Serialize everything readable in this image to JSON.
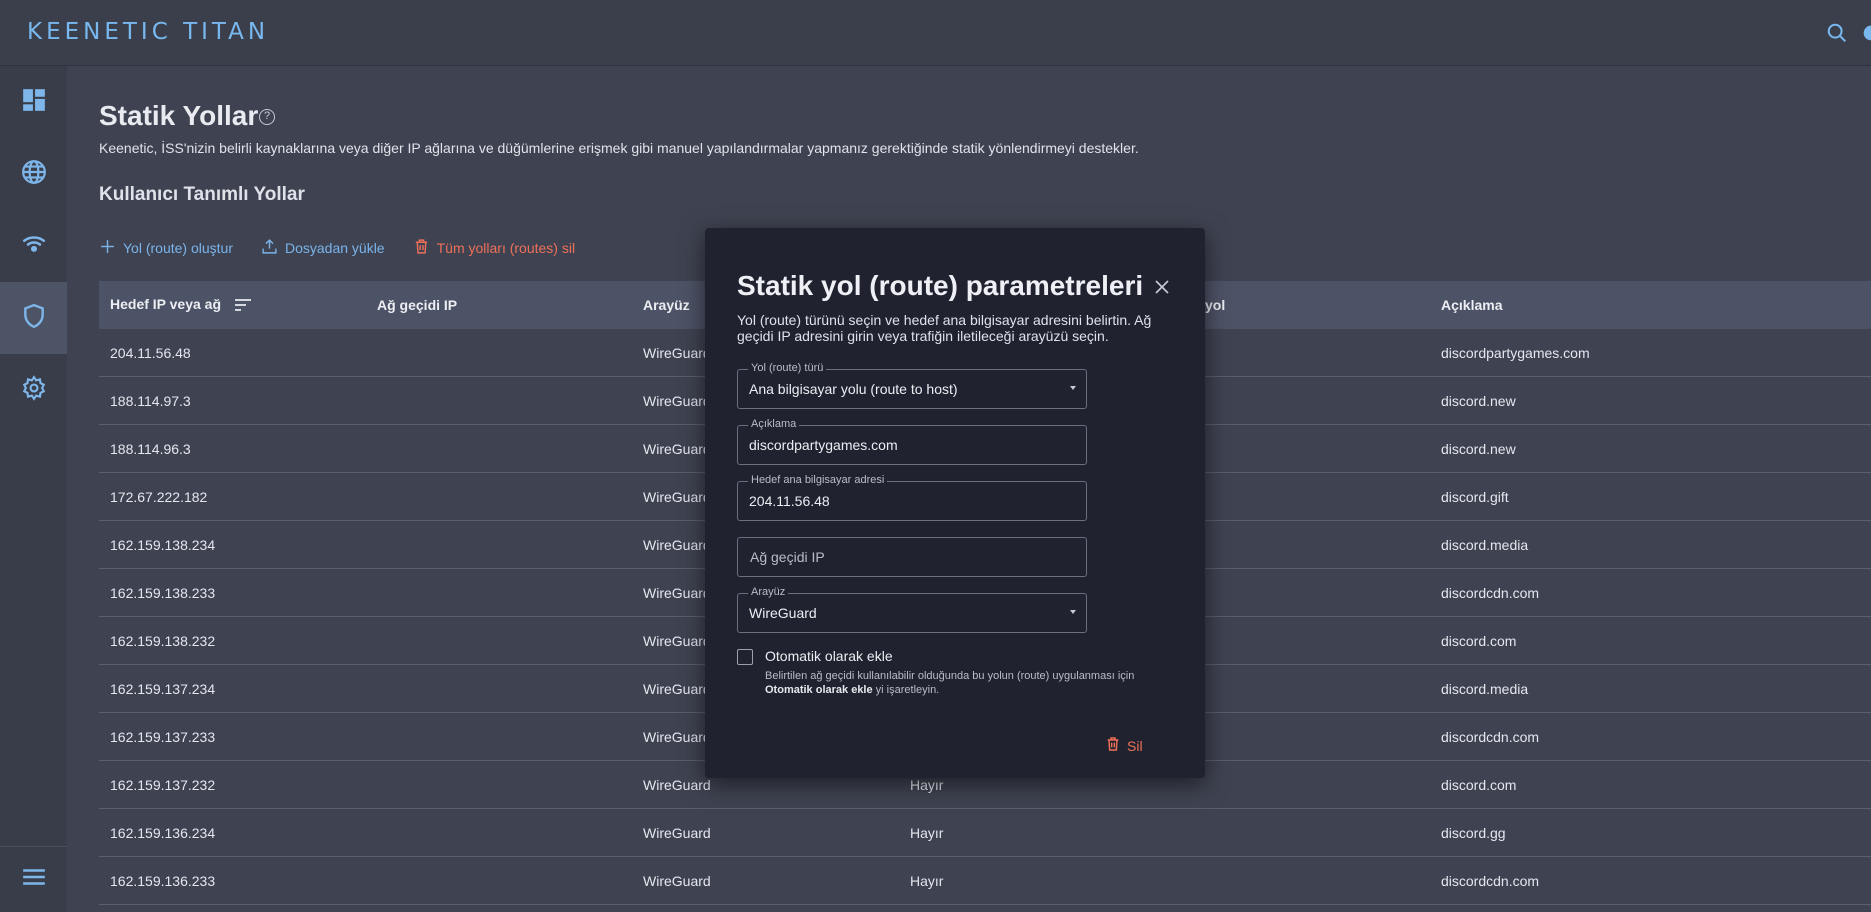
{
  "app": {
    "logo": "KEENETIC TITAN"
  },
  "topbar": {
    "search_icon": "search-icon",
    "settings_icon": "gear-icon"
  },
  "sidebar": {
    "items": [
      {
        "name": "dashboard",
        "icon": "dashboard-icon",
        "active": false
      },
      {
        "name": "internet",
        "icon": "globe-icon",
        "active": false
      },
      {
        "name": "wifi",
        "icon": "wifi-icon",
        "active": false
      },
      {
        "name": "security",
        "icon": "shield-icon",
        "active": true
      },
      {
        "name": "management",
        "icon": "gear-icon",
        "active": false
      }
    ],
    "menu_icon": "menu-icon"
  },
  "page": {
    "title": "Statik Yollar",
    "description": "Keenetic, İSS'nizin belirli kaynaklarına veya diğer IP ağlarına ve düğümlerine erişmek gibi manuel yapılandırmalar yapmanız gerektiğinde statik yönlendirmeyi destekler.",
    "section_title": "Kullanıcı Tanımlı Yollar"
  },
  "actions": {
    "create": "Yol (route) oluştur",
    "upload": "Dosyadan yükle",
    "delete_all": "Tüm yolları (routes) sil"
  },
  "table": {
    "headers": [
      "Hedef IP veya ağ",
      "Ağ geçidi IP",
      "Arayüz",
      "",
      "yol",
      "Açıklama"
    ],
    "rows": [
      {
        "dest": "204.11.56.48",
        "gateway": "",
        "iface": "WireGuard",
        "auto": "",
        "desc": "discordpartygames.com"
      },
      {
        "dest": "188.114.97.3",
        "gateway": "",
        "iface": "WireGuard",
        "auto": "",
        "desc": "discord.new"
      },
      {
        "dest": "188.114.96.3",
        "gateway": "",
        "iface": "WireGuard",
        "auto": "",
        "desc": "discord.new"
      },
      {
        "dest": "172.67.222.182",
        "gateway": "",
        "iface": "WireGuard",
        "auto": "",
        "desc": "discord.gift"
      },
      {
        "dest": "162.159.138.234",
        "gateway": "",
        "iface": "WireGuard",
        "auto": "",
        "desc": "discord.media"
      },
      {
        "dest": "162.159.138.233",
        "gateway": "",
        "iface": "WireGuard",
        "auto": "",
        "desc": "discordcdn.com"
      },
      {
        "dest": "162.159.138.232",
        "gateway": "",
        "iface": "WireGuard",
        "auto": "",
        "desc": "discord.com"
      },
      {
        "dest": "162.159.137.234",
        "gateway": "",
        "iface": "WireGuard",
        "auto": "",
        "desc": "discord.media"
      },
      {
        "dest": "162.159.137.233",
        "gateway": "",
        "iface": "WireGuard",
        "auto": "",
        "desc": "discordcdn.com"
      },
      {
        "dest": "162.159.137.232",
        "gateway": "",
        "iface": "WireGuard",
        "auto": "Hayır",
        "desc": "discord.com"
      },
      {
        "dest": "162.159.136.234",
        "gateway": "",
        "iface": "WireGuard",
        "auto": "Hayır",
        "desc": "discord.gg"
      },
      {
        "dest": "162.159.136.233",
        "gateway": "",
        "iface": "WireGuard",
        "auto": "Hayır",
        "desc": "discordcdn.com"
      }
    ]
  },
  "dialog": {
    "title": "Statik yol (route) parametreleri",
    "description": "Yol (route) türünü seçin ve hedef ana bilgisayar adresini belirtin. Ağ geçidi IP adresini girin veya trafiğin iletileceği arayüzü seçin.",
    "route_type": {
      "label": "Yol (route) türü",
      "value": "Ana bilgisayar yolu (route to host)"
    },
    "comment": {
      "label": "Açıklama",
      "value": "discordpartygames.com"
    },
    "host": {
      "label": "Hedef ana bilgisayar adresi",
      "value": "204.11.56.48"
    },
    "gateway": {
      "placeholder": "Ağ geçidi IP"
    },
    "interface": {
      "label": "Arayüz",
      "value": "WireGuard"
    },
    "auto": {
      "label": "Otomatik olarak ekle",
      "hint_before": "Belirtilen ağ geçidi kullanılabilir olduğunda bu yolun (route) uygulanması için ",
      "hint_bold": "Otomatik olarak ekle",
      "hint_after": " yi işaretleyin.",
      "checked": false
    },
    "delete": "Sil"
  },
  "colors": {
    "accent": "#78b8ee",
    "danger": "#ee7059",
    "dialog_bg": "#20232f",
    "page_bg": "#3f4351"
  }
}
